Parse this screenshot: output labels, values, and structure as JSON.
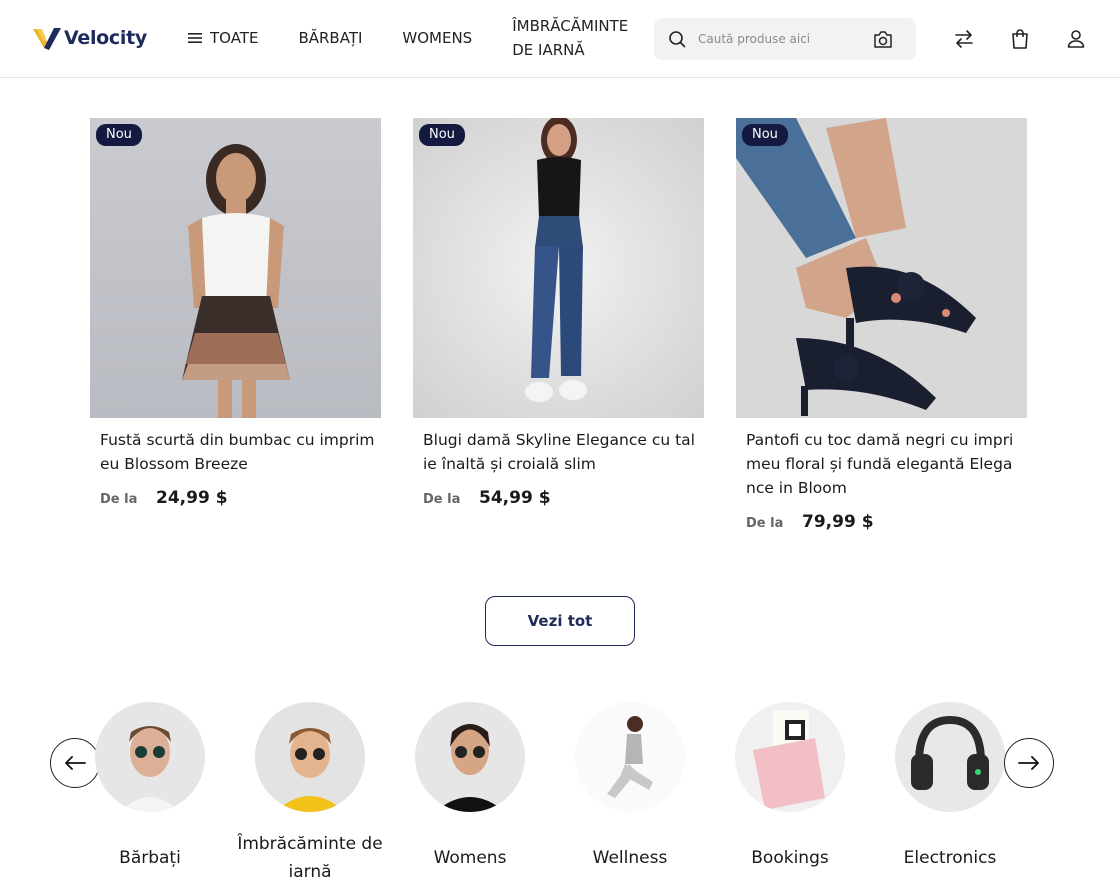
{
  "brand": {
    "name": "Velocity",
    "colors": {
      "navy": "#1e2a5a",
      "gold": "#f0b429"
    }
  },
  "nav": {
    "items": [
      {
        "label": "TOATE",
        "icon": "menu-icon"
      },
      {
        "label": "BĂRBAȚI"
      },
      {
        "label": "WOMENS"
      },
      {
        "label": "ÎMBRĂCĂMINTE DE IARNĂ"
      }
    ]
  },
  "search": {
    "placeholder": "Caută produse aici",
    "value": ""
  },
  "header_icons": [
    "compare-icon",
    "shopping-bag-icon",
    "user-icon"
  ],
  "products": [
    {
      "badge": "Nou",
      "title": "Fustă scurtă din bumbac cu imprimeu Blossom Breeze",
      "price_from": "De la",
      "price": "24,99 $"
    },
    {
      "badge": "Nou",
      "title": "Blugi damă Skyline Elegance cu talie înaltă și croială slim",
      "price_from": "De la",
      "price": "54,99 $"
    },
    {
      "badge": "Nou",
      "title": "Pantofi cu toc damă negri cu imprimeu floral și fundă elegantă Elegance in Bloom",
      "price_from": "De la",
      "price": "79,99 $"
    }
  ],
  "view_all_label": "Vezi tot",
  "categories": [
    {
      "label": "Bărbați"
    },
    {
      "label": "Îmbrăcăminte de iarnă"
    },
    {
      "label": "Womens"
    },
    {
      "label": "Wellness"
    },
    {
      "label": "Bookings"
    },
    {
      "label": "Electronics"
    }
  ]
}
